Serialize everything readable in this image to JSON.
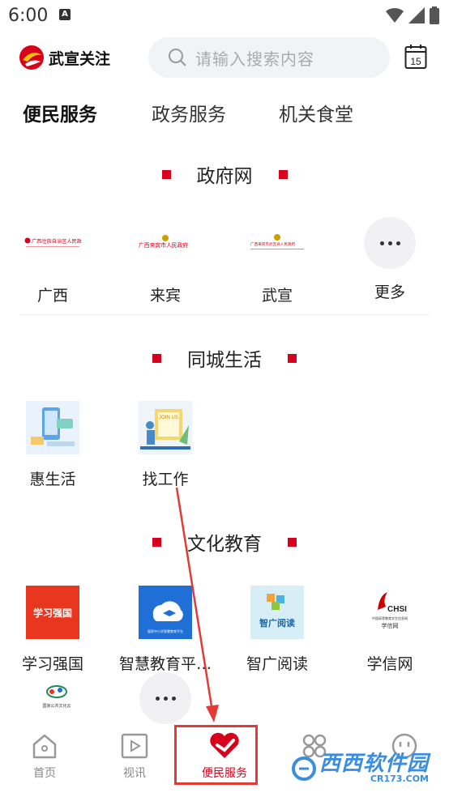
{
  "status_bar": {
    "time": "6:00",
    "badge": "A"
  },
  "header": {
    "logo_text": "武宣关注",
    "search_placeholder": "请输入搜索内容",
    "calendar_day": "15"
  },
  "tabs": [
    {
      "label": "便民服务",
      "active": true
    },
    {
      "label": "政务服务",
      "active": false
    },
    {
      "label": "机关食堂",
      "active": false
    }
  ],
  "sections": {
    "gov": {
      "title": "政府网",
      "items": [
        {
          "label": "广西",
          "logo_caption": "广西壮族自治区人民政府"
        },
        {
          "label": "来宾",
          "logo_caption": "广西来宾市人民政府"
        },
        {
          "label": "武宣",
          "logo_caption": "广西来宾市武宣县人民政府"
        },
        {
          "label": "更多"
        }
      ]
    },
    "life": {
      "title": "同城生活",
      "items": [
        {
          "label": "惠生活"
        },
        {
          "label": "找工作",
          "logo_caption": "JOIN US"
        }
      ]
    },
    "edu": {
      "title": "文化教育",
      "items": [
        {
          "label": "学习强国",
          "logo_caption": "学习强国"
        },
        {
          "label": "智慧教育平…",
          "logo_caption": "国家中小学智慧教育平台"
        },
        {
          "label": "智广阅读",
          "logo_caption": "智广阅读"
        },
        {
          "label": "学信网",
          "logo_caption": "CHSI 中国高等教育学生信息网 学信网"
        }
      ],
      "extra_logo_caption": "国家公共文化云"
    }
  },
  "bottom_nav": [
    {
      "label": "首页",
      "icon": "home-icon",
      "active": false
    },
    {
      "label": "视讯",
      "icon": "video-icon",
      "active": false
    },
    {
      "label": "便民服务",
      "icon": "heart-icon",
      "active": true
    },
    {
      "label": "",
      "icon": "apps-icon",
      "active": false
    },
    {
      "label": "",
      "icon": "smile-icon",
      "active": false
    }
  ],
  "watermark": {
    "text": "西西软件园",
    "sub": "CR173.COM"
  },
  "colors": {
    "accent": "#d9001b",
    "annotation": "#e53935"
  }
}
